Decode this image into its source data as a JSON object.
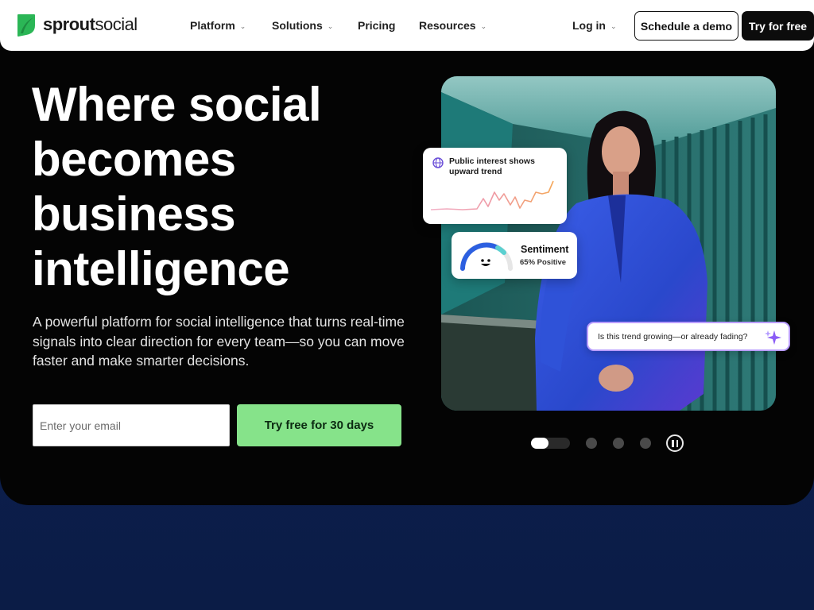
{
  "brand": {
    "name_bold": "sprout",
    "name_regular": "social",
    "accent": "#2bb656"
  },
  "nav": {
    "items": [
      {
        "label": "Platform",
        "has_menu": true
      },
      {
        "label": "Solutions",
        "has_menu": true
      },
      {
        "label": "Pricing",
        "has_menu": false
      },
      {
        "label": "Resources",
        "has_menu": true
      }
    ],
    "login": {
      "label": "Log in",
      "has_menu": true
    },
    "demo_label": "Schedule a demo",
    "try_label": "Try for free"
  },
  "hero": {
    "headline": [
      "Where social",
      "becomes",
      "business",
      "intelligence"
    ],
    "subtext": "A powerful platform for social intelligence that turns real-time signals into clear direction for every team—so you can move faster and make smarter decisions.",
    "email_placeholder": "Enter your email",
    "cta_label": "Try free for 30 days",
    "cta_color": "#86e38a"
  },
  "cards": {
    "trend_title": "Public interest shows upward trend",
    "sentiment_title": "Sentiment",
    "sentiment_value": "65% Positive",
    "sentiment_fraction": 0.65,
    "question": "Is this trend growing—or already fading?"
  },
  "carousel": {
    "slide_count": 4,
    "active_index": 0,
    "pause_icon": "pause-icon"
  }
}
